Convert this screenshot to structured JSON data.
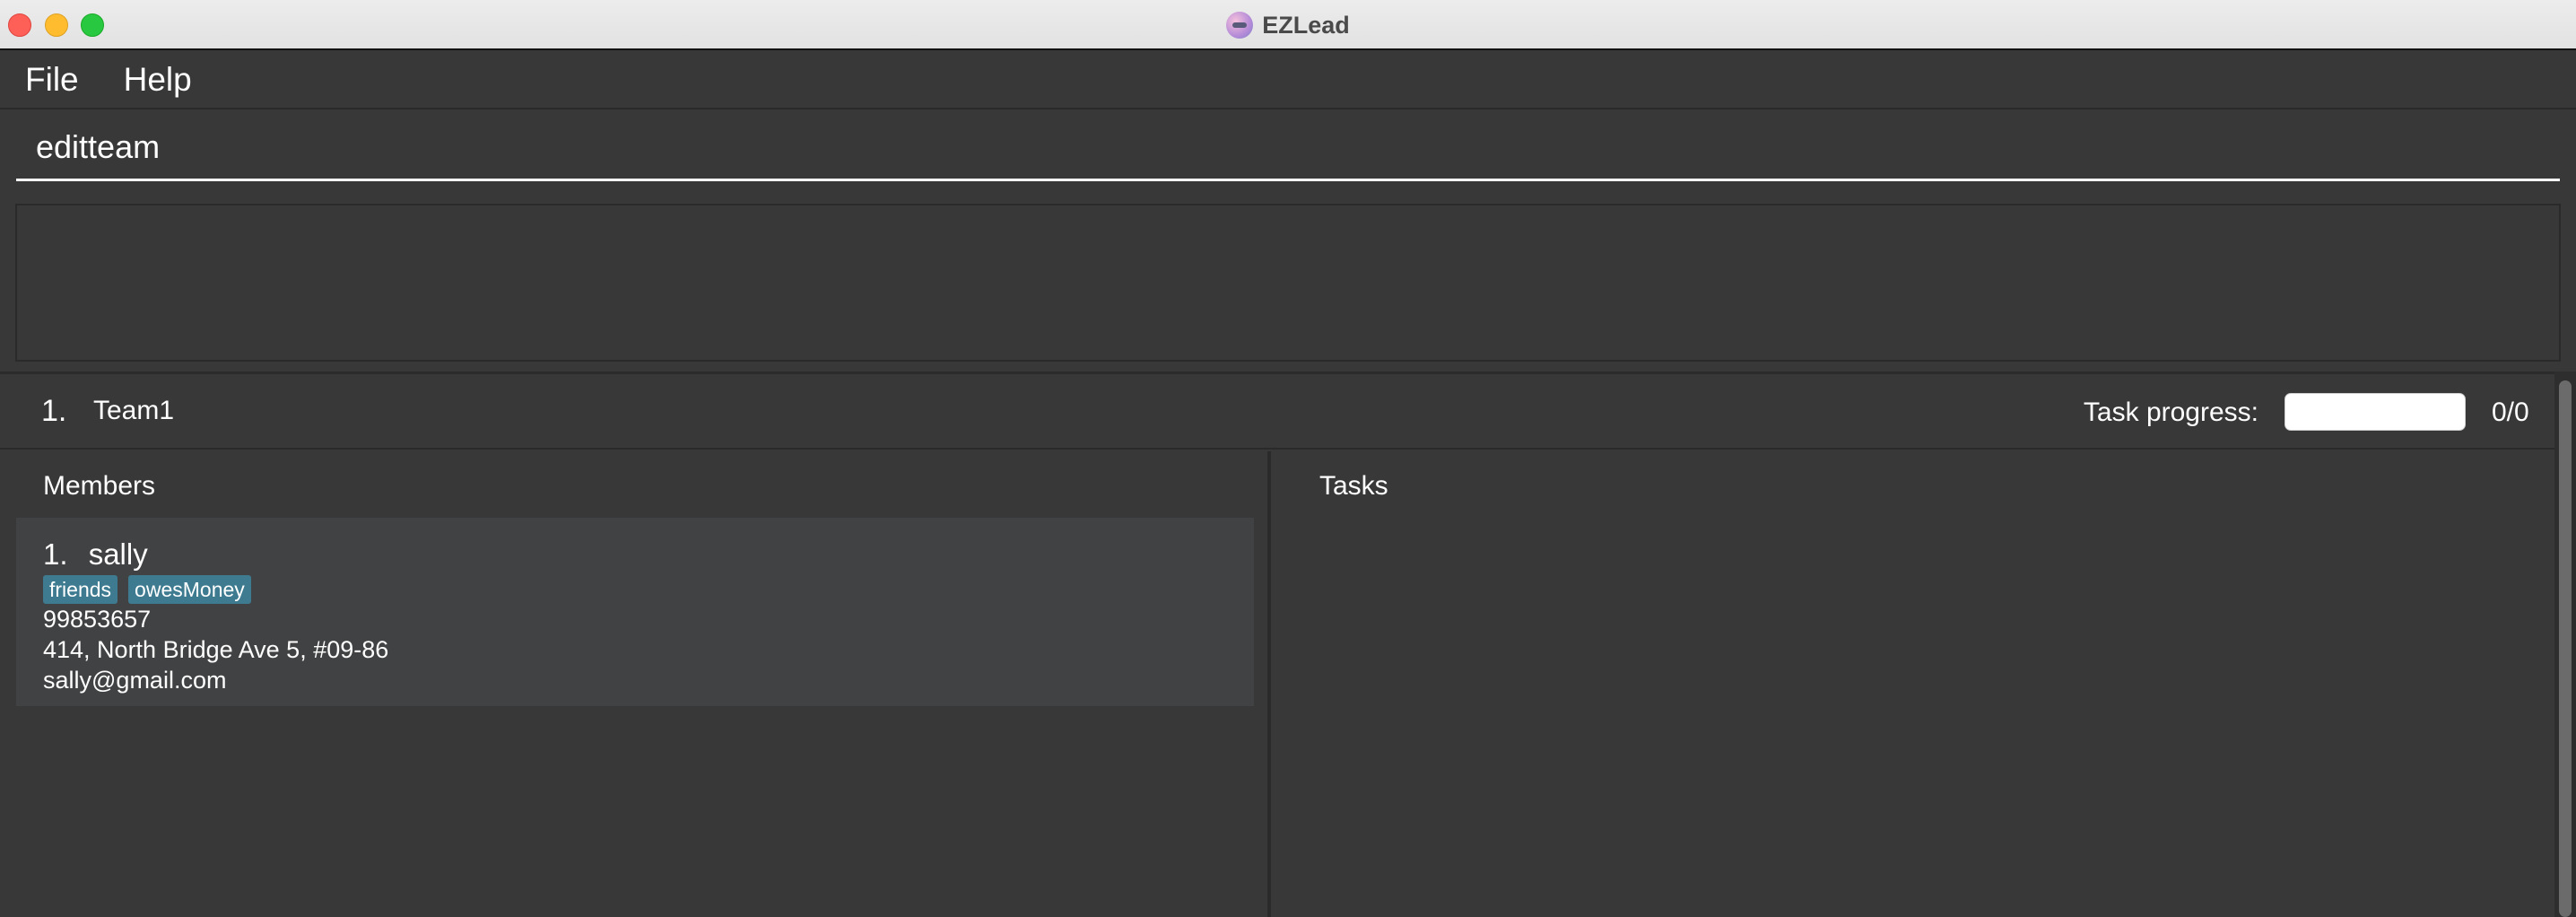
{
  "window": {
    "title": "EZLead"
  },
  "menu": {
    "file": "File",
    "help": "Help"
  },
  "command": {
    "value": "editteam"
  },
  "result": {
    "text": ""
  },
  "team": {
    "index": "1.",
    "name": "Team1",
    "progress_label": "Task progress:",
    "progress_fraction": 0,
    "progress_count": "0/0",
    "members_title": "Members",
    "tasks_title": "Tasks",
    "members": [
      {
        "index": "1.",
        "name": "sally",
        "tags": [
          "friends",
          "owesMoney"
        ],
        "phone": "99853657",
        "address": "414, North Bridge Ave 5, #09-86",
        "email": "sally@gmail.com"
      }
    ]
  },
  "colors": {
    "tag": "#3e7b91",
    "background": "#383838",
    "card": "#414243"
  }
}
